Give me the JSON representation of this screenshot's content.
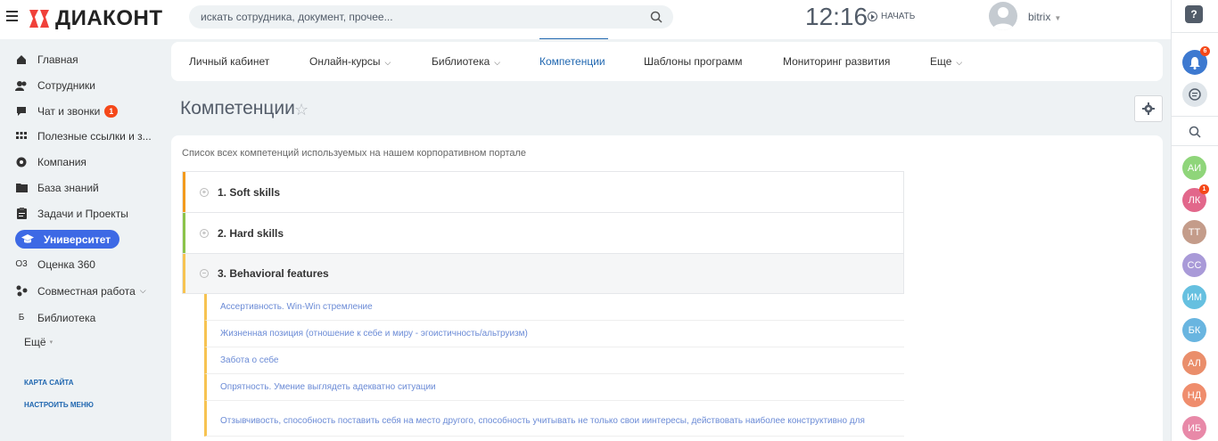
{
  "header": {
    "logo_text": "ДИАКОНТ",
    "search_placeholder": "искать сотрудника, документ, прочее...",
    "clock": "12:16",
    "start_label": "НАЧАТЬ",
    "username": "bitrix",
    "brand_color": "#f0413a"
  },
  "sidebar": {
    "items": [
      {
        "label": "Главная",
        "icon": "home-icon"
      },
      {
        "label": "Сотрудники",
        "icon": "users-icon"
      },
      {
        "label": "Чат и звонки",
        "icon": "chat-icon",
        "badge": "1"
      },
      {
        "label": "Полезные ссылки и з...",
        "icon": "grid-icon"
      },
      {
        "label": "Компания",
        "icon": "company-icon"
      },
      {
        "label": "База знаний",
        "icon": "folder-icon"
      },
      {
        "label": "Задачи и Проекты",
        "icon": "tasks-icon"
      },
      {
        "label": "Университет",
        "icon": "graduation-cap-icon",
        "active": true
      },
      {
        "label": "Оценка 360",
        "icon": "O3"
      },
      {
        "label": "Совместная работа",
        "icon": "collab-icon"
      },
      {
        "label": "Библиотека",
        "icon": "Б"
      }
    ],
    "more": "Ещё",
    "sitemap": "КАРТА САЙТА",
    "configure": "НАСТРОИТЬ МЕНЮ"
  },
  "tabs": [
    {
      "label": "Личный кабинет"
    },
    {
      "label": "Онлайн-курсы"
    },
    {
      "label": "Библиотека"
    },
    {
      "label": "Компетенции",
      "active": true
    },
    {
      "label": "Шаблоны программ"
    },
    {
      "label": "Мониторинг развития"
    },
    {
      "label": "Еще"
    }
  ],
  "page": {
    "title": "Компетенции",
    "description": "Список всех компетенций используемых на нашем корпоративном портале"
  },
  "sections": [
    {
      "label": "1. Soft skills",
      "color": "#f39a1c",
      "toggle": "+"
    },
    {
      "label": "2. Hard skills",
      "color": "#8bc34a",
      "toggle": "+"
    },
    {
      "label": "3. Behavioral features",
      "color": "#f7c351",
      "toggle": "−"
    }
  ],
  "subitems": [
    "Ассертивность. Win-Win стремление",
    "Жизненная позиция (отношение к себе и миру - эгоистичность/альтруизм)",
    "Забота о себе",
    "Опрятность. Умение выглядеть адекватно ситуации",
    "Отзывчивость, способность поставить себя на место другого, способность учитывать не только свои иинтересы, действовать наиболее конструктивно для взаимодействия"
  ],
  "rightbar": {
    "help": "?",
    "notifications_badge": "6",
    "users": [
      {
        "initials": "АИ",
        "color": "#8fd57a"
      },
      {
        "initials": "ЛК",
        "color": "#e2678b",
        "badge": "1"
      },
      {
        "initials": "ТТ",
        "color": "#c49c8a"
      },
      {
        "initials": "СС",
        "color": "#a99ad8"
      },
      {
        "initials": "ИМ",
        "color": "#66c0e0"
      },
      {
        "initials": "БК",
        "color": "#69b5e0"
      },
      {
        "initials": "АЛ",
        "color": "#ea8e6b"
      },
      {
        "initials": "НД",
        "color": "#ef8d6d"
      },
      {
        "initials": "ИБ",
        "color": "#e889a8"
      }
    ]
  }
}
